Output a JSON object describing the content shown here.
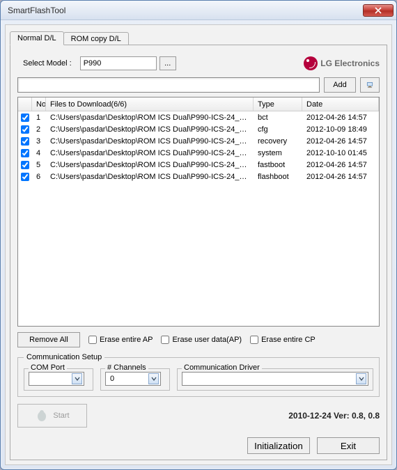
{
  "window": {
    "title": "SmartFlashTool"
  },
  "tabs": {
    "normal": "Normal D/L",
    "romcopy": "ROM copy D/L"
  },
  "model": {
    "label": "Select Model :",
    "value": "P990",
    "browse": "..."
  },
  "brand": "LG Electronics",
  "path": {
    "value": "",
    "add": "Add"
  },
  "list": {
    "hdr_no": "No",
    "hdr_file": "Files to Download(6/6)",
    "hdr_type": "Type",
    "hdr_date": "Date",
    "rows": [
      {
        "no": "1",
        "file": "C:\\Users\\pasdar\\Desktop\\ROM ICS Dual\\P990-ICS-24_0...",
        "type": "bct",
        "date": "2012-04-26 14:57"
      },
      {
        "no": "2",
        "file": "C:\\Users\\pasdar\\Desktop\\ROM ICS Dual\\P990-ICS-24_0...",
        "type": "cfg",
        "date": "2012-10-09 18:49"
      },
      {
        "no": "3",
        "file": "C:\\Users\\pasdar\\Desktop\\ROM ICS Dual\\P990-ICS-24_0...",
        "type": "recovery",
        "date": "2012-04-26 14:57"
      },
      {
        "no": "4",
        "file": "C:\\Users\\pasdar\\Desktop\\ROM ICS Dual\\P990-ICS-24_0...",
        "type": "system",
        "date": "2012-10-10 01:45"
      },
      {
        "no": "5",
        "file": "C:\\Users\\pasdar\\Desktop\\ROM ICS Dual\\P990-ICS-24_0...",
        "type": "fastboot",
        "date": "2012-04-26 14:57"
      },
      {
        "no": "6",
        "file": "C:\\Users\\pasdar\\Desktop\\ROM ICS Dual\\P990-ICS-24_0...",
        "type": "flashboot",
        "date": "2012-04-26 14:57"
      }
    ]
  },
  "options": {
    "remove_all": "Remove All",
    "erase_ap": "Erase entire AP",
    "erase_userdata": "Erase user data(AP)",
    "erase_cp": "Erase entire CP"
  },
  "comm": {
    "legend": "Communication Setup",
    "comport_label": "COM Port",
    "comport_value": "",
    "channels_label": "# Channels",
    "channels_value": "0",
    "driver_label": "Communication Driver",
    "driver_value": ""
  },
  "start": "Start",
  "version": "2010-12-24     Ver: 0.8, 0.8",
  "footer": {
    "init": "Initialization",
    "exit": "Exit"
  }
}
